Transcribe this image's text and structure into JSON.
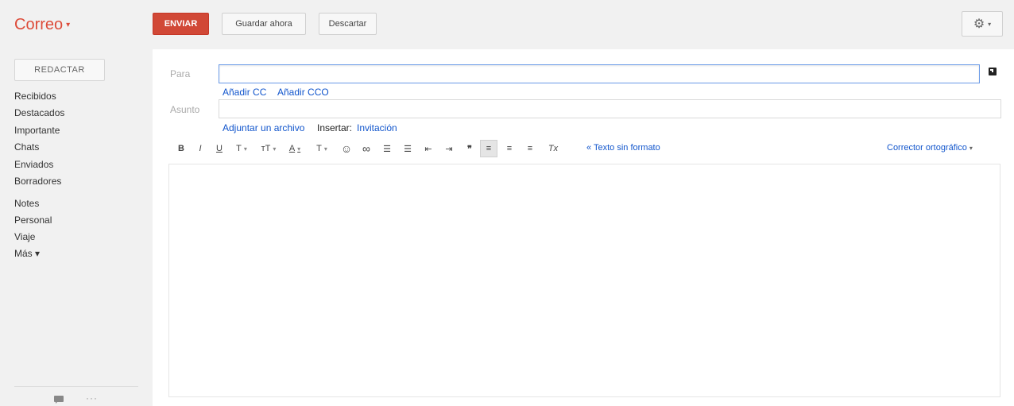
{
  "app": {
    "title": "Correo",
    "title_caret": "▾"
  },
  "toolbar": {
    "send_label": "ENVIAR",
    "save_label": "Guardar ahora",
    "discard_label": "Descartar",
    "settings_icon": "⚙",
    "settings_caret": "▾"
  },
  "sidebar": {
    "compose_label": "REDACTAR",
    "items": [
      {
        "label": "Recibidos"
      },
      {
        "label": "Destacados"
      },
      {
        "label": "Importante"
      },
      {
        "label": "Chats"
      },
      {
        "label": "Enviados"
      },
      {
        "label": "Borradores"
      },
      {
        "label": "Notes"
      },
      {
        "label": "Personal"
      },
      {
        "label": "Viaje"
      },
      {
        "label": "Más ▾"
      }
    ],
    "more_dots": "···"
  },
  "compose": {
    "to_label": "Para",
    "to_value": "",
    "cc_link": "Añadir CC",
    "bcc_link": "Añadir CCO",
    "subject_label": "Asunto",
    "subject_value": "",
    "attach_link": "Adjuntar un archivo",
    "insert_label": "Insertar:",
    "invite_link": "Invitación",
    "body_value": ""
  },
  "format": {
    "bold": "B",
    "italic": "I",
    "underline": "U",
    "font": "T",
    "size": "тT",
    "text_color": "A",
    "bg_color": "T",
    "emoji": "☺",
    "link": "∞",
    "numbered_list": "☰",
    "bulleted_list": "☰",
    "indent_less": "⇤",
    "indent_more": "⇥",
    "quote": "❞",
    "align_left": "≡",
    "align_center": "≡",
    "align_right": "≡",
    "remove_format": "Tx",
    "caret": "▾",
    "plain_text_link": "« Texto sin formato",
    "spellcheck_label": "Corrector ortográfico",
    "spellcheck_caret": "▾"
  },
  "colors": {
    "accent_red": "#d14836",
    "link_blue": "#1155cc",
    "logo_red": "#dd4b39"
  }
}
